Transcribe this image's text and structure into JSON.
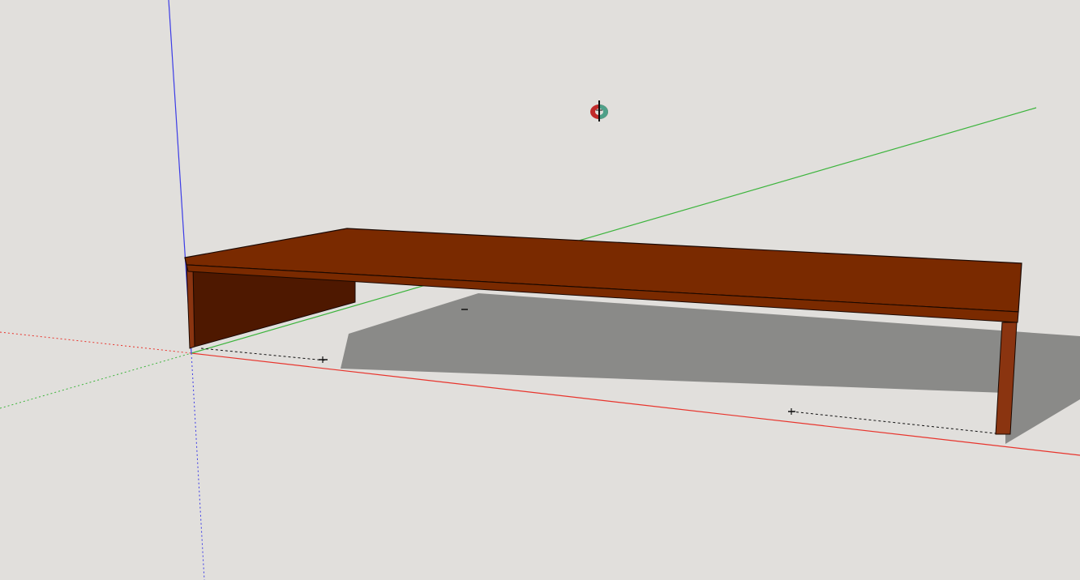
{
  "app": {
    "viewport_background": "#e1dfdc"
  },
  "colors": {
    "red_axis": "#e8342c",
    "green_axis": "#3cb43c",
    "blue_axis": "#3c3ce6",
    "wood_top": "#7a2a00",
    "wood_side_dark": "#4e1800",
    "wood_leg": "#8a3410",
    "shadow": "#8a8a88",
    "edge": "#1a0800"
  },
  "icons": {
    "orbit_cursor": "orbit-icon",
    "inference_markers": "guide-point-icon"
  },
  "model": {
    "object": "table",
    "material": "wood"
  }
}
